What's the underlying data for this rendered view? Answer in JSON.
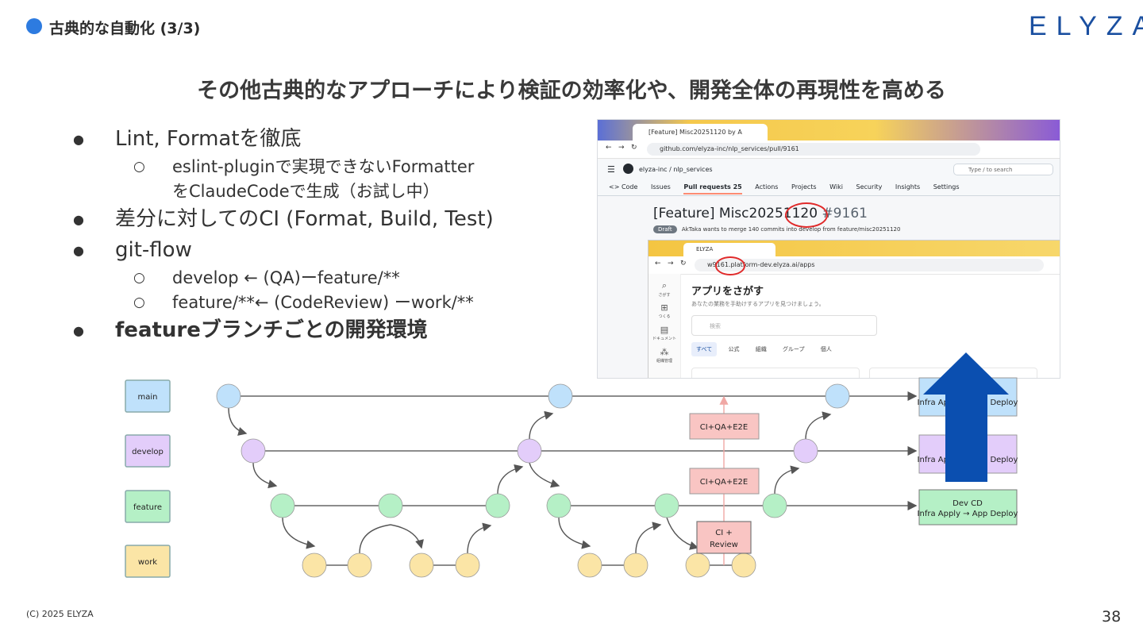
{
  "header": {
    "section_title": "古典的な自動化 (3/3)",
    "logo_text": "ELYZA"
  },
  "title": "その他古典的なアプローチにより検証の効率化や、開発全体の再現性を高める",
  "bullets": {
    "b1": "Lint, Formatを徹底",
    "b1_sub1_line1": "eslint-pluginで実現できないFormatter",
    "b1_sub1_line2": "をClaudeCodeで生成（お試し中）",
    "b2": "差分に対してのCI (Format, Build, Test)",
    "b3": "git-flow",
    "b3_sub1": "develop ← (QA)ーfeature/**",
    "b3_sub2": "feature/**← (CodeReview) ーwork/**",
    "b4": "featureブランチごとの開発環境"
  },
  "screenshot": {
    "tab_title": "[Feature] Misc20251120 by A",
    "url": "github.com/elyza-inc/nlp_services/pull/9161",
    "repo": "elyza-inc / nlp_services",
    "search_placeholder": "Type / to search",
    "nav": [
      "<> Code",
      "Issues",
      "Pull requests 25",
      "Actions",
      "Projects",
      "Wiki",
      "Security",
      "Insights",
      "Settings"
    ],
    "pr_title": "[Feature] Misc20251120",
    "pr_number": "#9161",
    "draft_label": "Draft",
    "draft_text": "AkTaka wants to merge 140 commits into develop from feature/misc20251120",
    "inner_tab": "ELYZA",
    "inner_url": "w9161.platform-dev.elyza.ai/apps",
    "sidebar": [
      "さがす",
      "つくる",
      "ドキュメント",
      "組織管理"
    ],
    "app_title": "アプリをさがす",
    "app_sub": "あなたの業務を手助けするアプリを見つけましょう。",
    "app_search_placeholder": "検索",
    "filters": [
      "すべて",
      "公式",
      "組織",
      "グループ",
      "個人"
    ]
  },
  "diagram": {
    "lanes": [
      "main",
      "develop",
      "feature",
      "work"
    ],
    "ci_boxes": [
      "CI+QA+E2E",
      "CI+QA+E2E",
      "CI + Review"
    ],
    "deploy_boxes": [
      "Infra Apply → App Deploy",
      "Infra Apply → App Deploy",
      "Dev CD",
      "Infra Apply → App Deploy"
    ],
    "colors": {
      "main": "#bfe1fb",
      "develop": "#e3cdfa",
      "feature": "#b5f0c6",
      "work": "#fbe5a6",
      "ci": "#f9c5c3",
      "arrow": "#0b4fb0"
    }
  },
  "footer": {
    "copyright": "(C) 2025 ELYZA",
    "page_number": "38"
  }
}
